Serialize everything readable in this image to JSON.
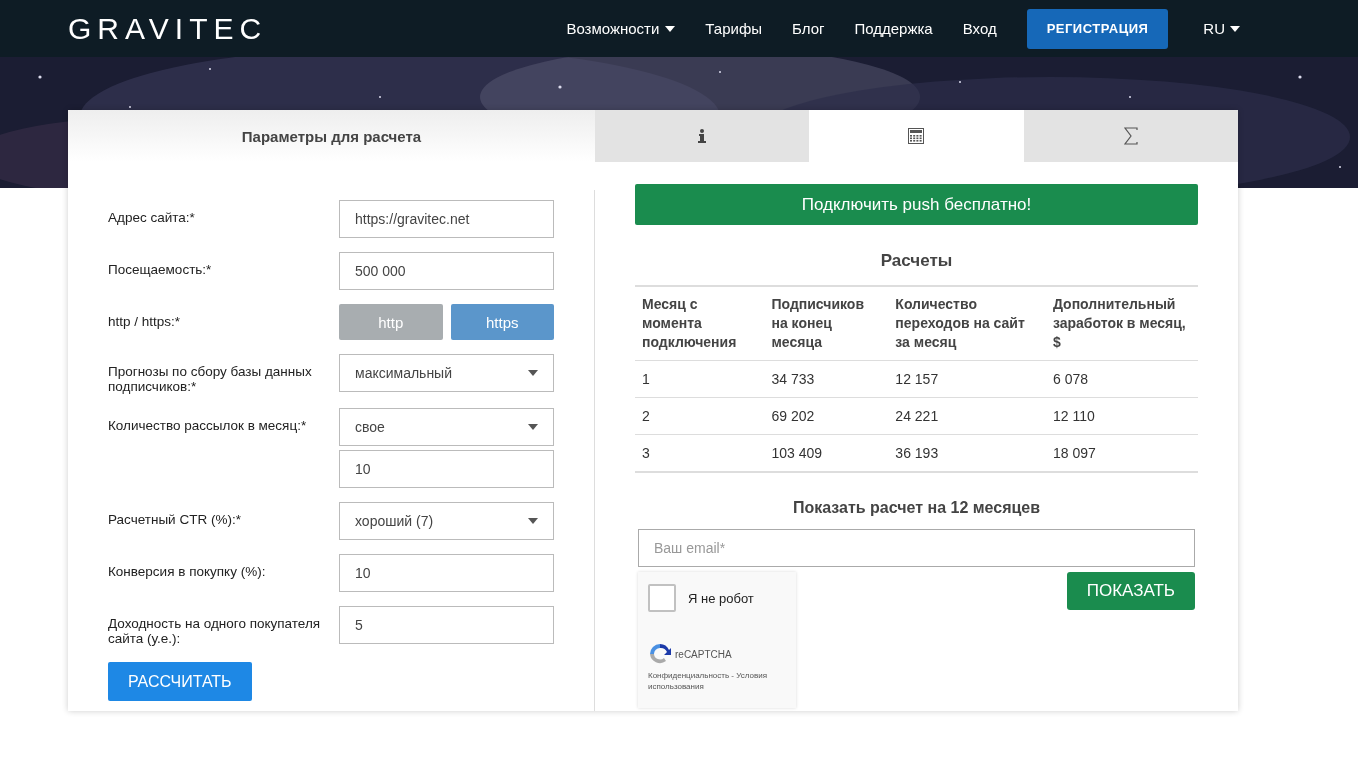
{
  "header": {
    "logo": "GRAVITEC",
    "nav": [
      {
        "label": "Возможности",
        "dropdown": true
      },
      {
        "label": "Тарифы",
        "dropdown": false
      },
      {
        "label": "Блог",
        "dropdown": false
      },
      {
        "label": "Поддержка",
        "dropdown": false
      },
      {
        "label": "Вход",
        "dropdown": false
      }
    ],
    "register": "РЕГИСТРАЦИЯ",
    "language": "RU"
  },
  "panel_title": "Параметры для расчета",
  "tabs": [
    {
      "kind": "info",
      "selected": false
    },
    {
      "kind": "calculator",
      "selected": true
    },
    {
      "kind": "sum",
      "selected": false
    }
  ],
  "form": [
    {
      "label": "Адрес сайта:*",
      "controls": [
        {
          "kind": "input",
          "value": "https://gravitec.net"
        }
      ]
    },
    {
      "label": "Посещаемость:*",
      "controls": [
        {
          "kind": "input",
          "value": "500 000"
        }
      ]
    },
    {
      "label": "http / https:*",
      "controls": [
        {
          "kind": "toggle",
          "options": [
            {
              "label": "http",
              "selected": false
            },
            {
              "label": "https",
              "selected": true
            }
          ]
        }
      ]
    },
    {
      "label": "Прогнозы по сбору базы данных подписчиков:*",
      "controls": [
        {
          "kind": "select",
          "value": "максимальный"
        }
      ]
    },
    {
      "label": "Количество рассылок в месяц:*",
      "controls": [
        {
          "kind": "select",
          "value": "свое"
        },
        {
          "kind": "input",
          "value": "10"
        }
      ]
    },
    {
      "label": "Расчетный CTR (%):*",
      "controls": [
        {
          "kind": "select",
          "value": "хороший (7)"
        }
      ]
    },
    {
      "label": "Конверсия в покупку (%):",
      "controls": [
        {
          "kind": "input",
          "value": "10"
        }
      ]
    },
    {
      "label": "Доходность на одного покупателя сайта (у.е.):",
      "controls": [
        {
          "kind": "input",
          "value": "5"
        }
      ]
    }
  ],
  "calculate_button": "РАССЧИТАТЬ",
  "connect_button": "Подключить push бесплатно!",
  "results": {
    "title": "Расчеты",
    "columns": [
      "Месяц с момента подключения",
      "Подписчиков на конец месяца",
      "Количество переходов на сайт за месяц",
      "Дополнительный заработок в месяц, $"
    ],
    "rows": [
      [
        "1",
        "34 733",
        "12 157",
        "6 078"
      ],
      [
        "2",
        "69 202",
        "24 221",
        "12 110"
      ],
      [
        "3",
        "103 409",
        "36 193",
        "18 097"
      ]
    ]
  },
  "show_title": "Показать расчет на 12 месяцев",
  "email": {
    "placeholder": "Ваш email*"
  },
  "show_button": "ПОКАЗАТЬ",
  "captcha": {
    "label": "Я не робот",
    "checked": false,
    "brand": "reCAPTCHA",
    "links": "Конфиденциальность - Условия использования"
  }
}
